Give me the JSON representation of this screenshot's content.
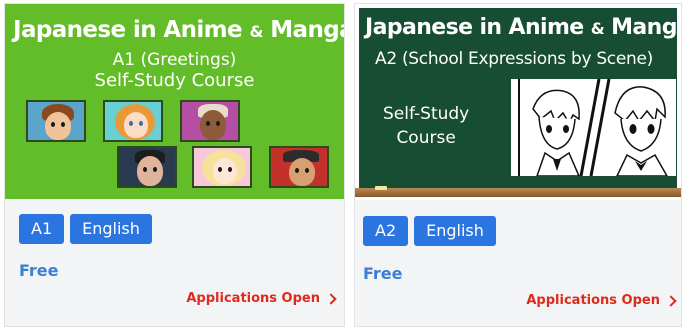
{
  "courses": [
    {
      "banner": {
        "title_main": "Japanese in Anime",
        "title_amp": "&",
        "title_end": "Manga",
        "subtitle_line1": "A1 (Greetings)",
        "subtitle_line2": "Self-Study Course",
        "background_color": "#63bd28"
      },
      "tags": [
        "A1",
        "English"
      ],
      "price": "Free",
      "status_link": "Applications Open",
      "colors": {
        "tag": "#2b75e0",
        "price": "#3b7fd1",
        "status": "#dd2b1d"
      }
    },
    {
      "banner": {
        "title_main": "Japanese in Anime",
        "title_amp": "&",
        "title_end": "Manga",
        "subtitle_line1": "A2 (School Expressions by Scene)",
        "subtitle_line2": "Self-Study",
        "subtitle_line3": "Course",
        "background_color": "#174d32"
      },
      "tags": [
        "A2",
        "English"
      ],
      "price": "Free",
      "status_link": "Applications Open",
      "colors": {
        "tag": "#2b75e0",
        "price": "#3b7fd1",
        "status": "#dd2b1d"
      }
    }
  ]
}
